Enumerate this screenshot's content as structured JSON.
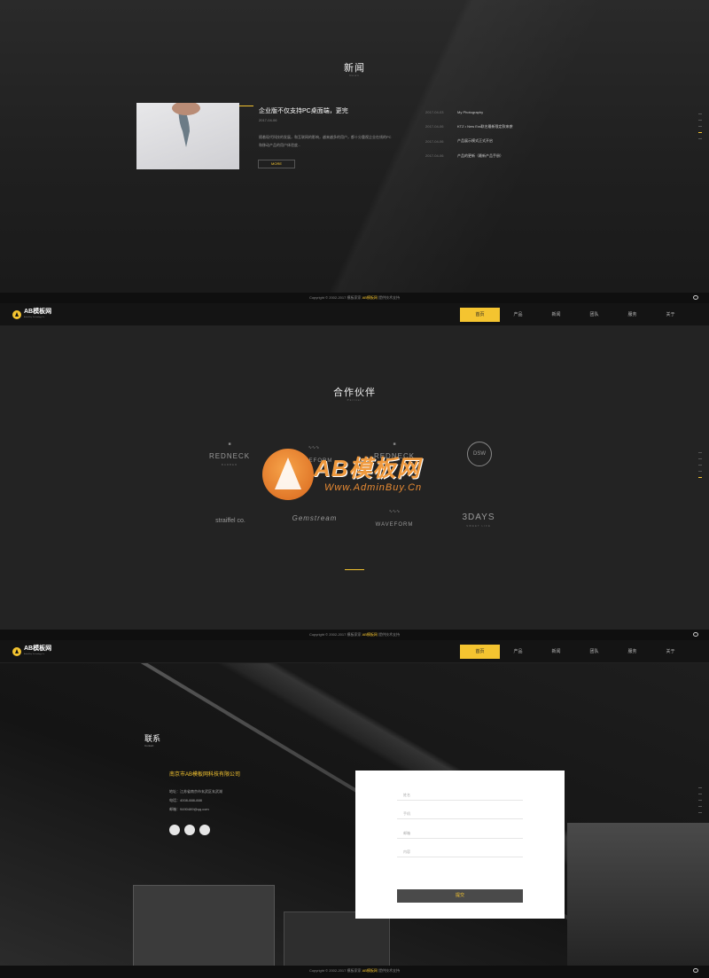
{
  "news": {
    "title": "新闻",
    "subtitle": "News",
    "feature": {
      "title": "企业版不仅支持PC桌面端，更完",
      "date": "2017-04-06",
      "desc": "随着现代科技的发展，和互联网的影响，越来越多的用户，都十分重视企业在线的PC和移动产品的用户体验度...",
      "more": "MORE"
    },
    "list": [
      {
        "date": "2017-04-03",
        "title": "My Photography"
      },
      {
        "date": "2017-04-06",
        "title": "KTZ • New Era联名最新限定款来袭"
      },
      {
        "date": "2017-04-06",
        "title": "产品展示模式正式开启"
      },
      {
        "date": "2017-04-06",
        "title": "产品的更新（最新产品手册）"
      }
    ]
  },
  "footer": {
    "copyright_left": "Copyright © 2002-2017 模板家家",
    "brand": "AB模板网",
    "copyright_right": "提供技术支持"
  },
  "nav": {
    "logo": "AB模板网",
    "logo_tagline": "AdminBuy Technology Co.",
    "items": [
      "首页",
      "产品",
      "新闻",
      "团队",
      "服务",
      "关于"
    ]
  },
  "partners": {
    "title": "合作伙伴",
    "subtitle": "Partner",
    "items": [
      {
        "name": "REDNECK",
        "tag": "BARBER"
      },
      {
        "name": "WAVEFORM",
        "tag": ""
      },
      {
        "name": "REDNECK",
        "tag": "BARBER"
      },
      {
        "name": "DSW",
        "tag": ""
      },
      {
        "name": "straiffel co.",
        "tag": ""
      },
      {
        "name": "Gemstream",
        "tag": ""
      },
      {
        "name": "WAVEFORM",
        "tag": ""
      },
      {
        "name": "3DAYS",
        "tag": "SWEET LIFE"
      }
    ],
    "watermark": {
      "text": "AB模板网",
      "url": "Www.AdminBuy.Cn"
    }
  },
  "contact": {
    "title": "联系",
    "subtitle": "Contact",
    "company": "南京市AB模板网科技有限公司",
    "address": "地址：江苏省南京市玄武区玄武湖",
    "phone": "电话：4008-888-888",
    "email": "邮箱：9490489@qq.com",
    "form": {
      "name_placeholder": "姓名",
      "phone_placeholder": "手机",
      "email_placeholder": "邮箱",
      "content_placeholder": "内容",
      "submit": "提交"
    }
  },
  "colors": {
    "accent": "#f4c430",
    "nav_bg": "#141414",
    "panel_bg": "#232323"
  }
}
